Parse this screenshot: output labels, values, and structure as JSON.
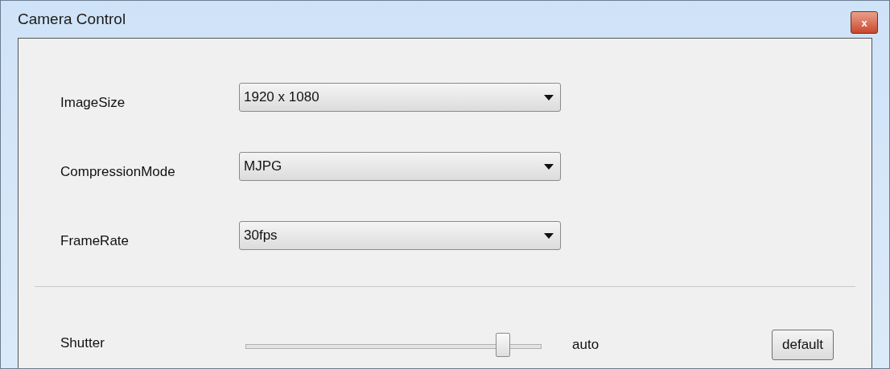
{
  "window": {
    "title": "Camera Control",
    "close_label": "x"
  },
  "settings": [
    {
      "label": "ImageSize",
      "value": "1920 x 1080"
    },
    {
      "label": "CompressionMode",
      "value": "MJPG"
    },
    {
      "label": "FrameRate",
      "value": "30fps"
    }
  ],
  "sliders": [
    {
      "label": "Shutter",
      "level": 0.87,
      "reading": "auto",
      "button": "default"
    }
  ]
}
